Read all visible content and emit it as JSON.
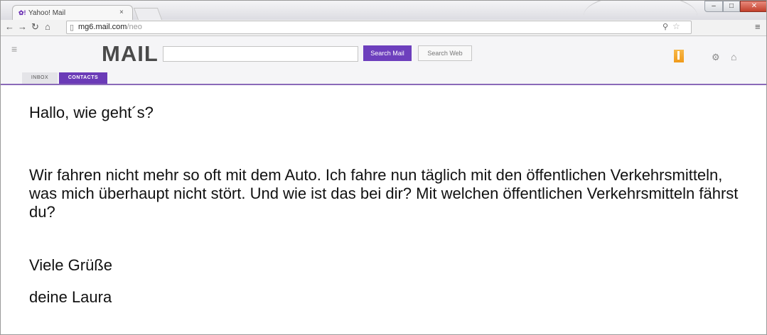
{
  "browser": {
    "tab_title": "Yahoo! Mail",
    "tab_close": "×",
    "url_host": "mg6.mail.com",
    "url_path": "/neo",
    "window_controls": [
      "–",
      "□",
      "✕"
    ]
  },
  "mail": {
    "logo": "MAIL",
    "search_placeholder": "",
    "search_mail_label": "Search Mail",
    "search_web_label": "Search Web",
    "tabs": [
      "INBOX",
      "CONTACTS"
    ],
    "accent_color": "#6b3bb7"
  },
  "message": {
    "greeting": "Hallo, wie geht´s?",
    "body": "Wir fahren nicht mehr so oft mit dem Auto. Ich fahre nun täglich mit den öffentlichen Verkehrsmitteln, was mich überhaupt nicht stört. Und wie ist das bei dir? Mit welchen öffentlichen Verkehrsmitteln fährst du?",
    "closing": "Viele Grüße",
    "signature": "deine Laura"
  }
}
